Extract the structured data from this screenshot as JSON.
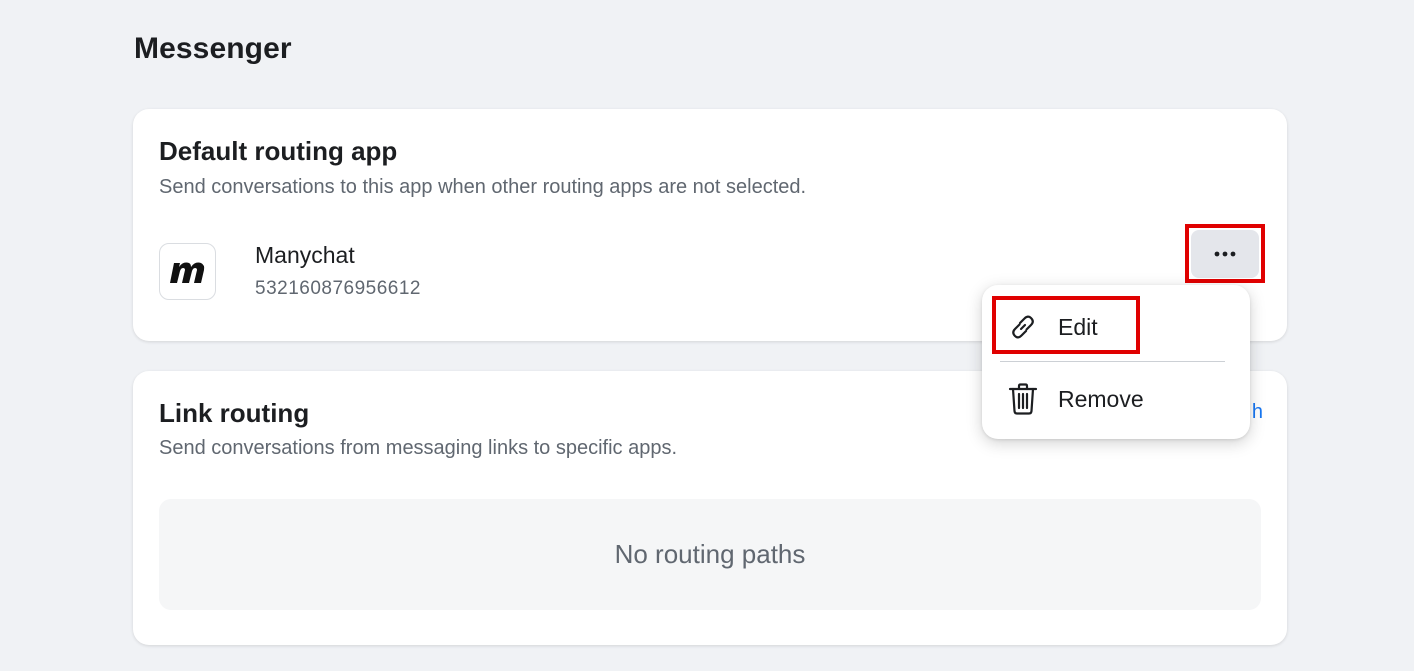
{
  "page": {
    "title": "Messenger"
  },
  "default_routing": {
    "title": "Default routing app",
    "subtitle": "Send conversations to this app when other routing apps are not selected.",
    "app": {
      "name": "Manychat",
      "id": "532160876956612",
      "logo_icon": "manychat-logo"
    },
    "more_button_label": "···"
  },
  "link_routing": {
    "title": "Link routing",
    "subtitle": "Send conversations from messaging links to specific apps.",
    "cta_partial": "h",
    "empty_text": "No routing paths"
  },
  "menu": {
    "items": [
      {
        "label": "Edit",
        "icon": "link-icon"
      },
      {
        "label": "Remove",
        "icon": "trash-icon"
      }
    ]
  },
  "colors": {
    "highlight": "#e00000",
    "link": "#1877f2",
    "background": "#f0f2f5"
  }
}
